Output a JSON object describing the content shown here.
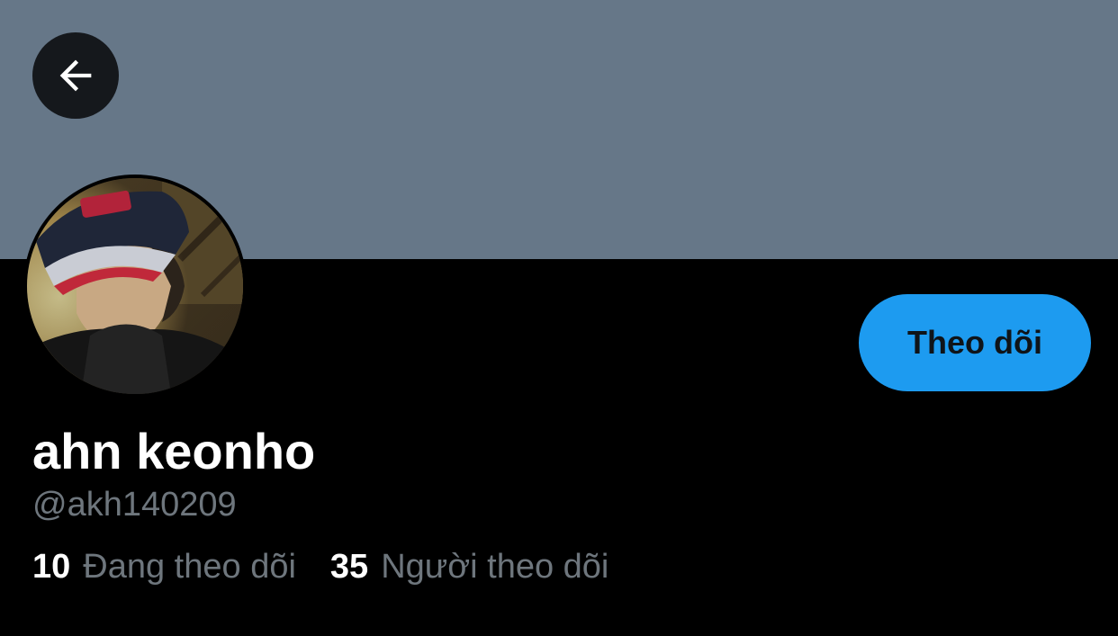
{
  "profile": {
    "display_name": "ahn keonho",
    "handle": "@akh140209",
    "follow_button_label": "Theo dõi",
    "stats": {
      "following_count": "10",
      "following_label": "Đang theo dõi",
      "followers_count": "35",
      "followers_label": "Người theo dõi"
    }
  },
  "icons": {
    "back": "arrow-left-icon"
  },
  "colors": {
    "banner": "#667788",
    "background": "#000000",
    "accent": "#1d9bf0",
    "secondary_text": "#6e767d"
  }
}
